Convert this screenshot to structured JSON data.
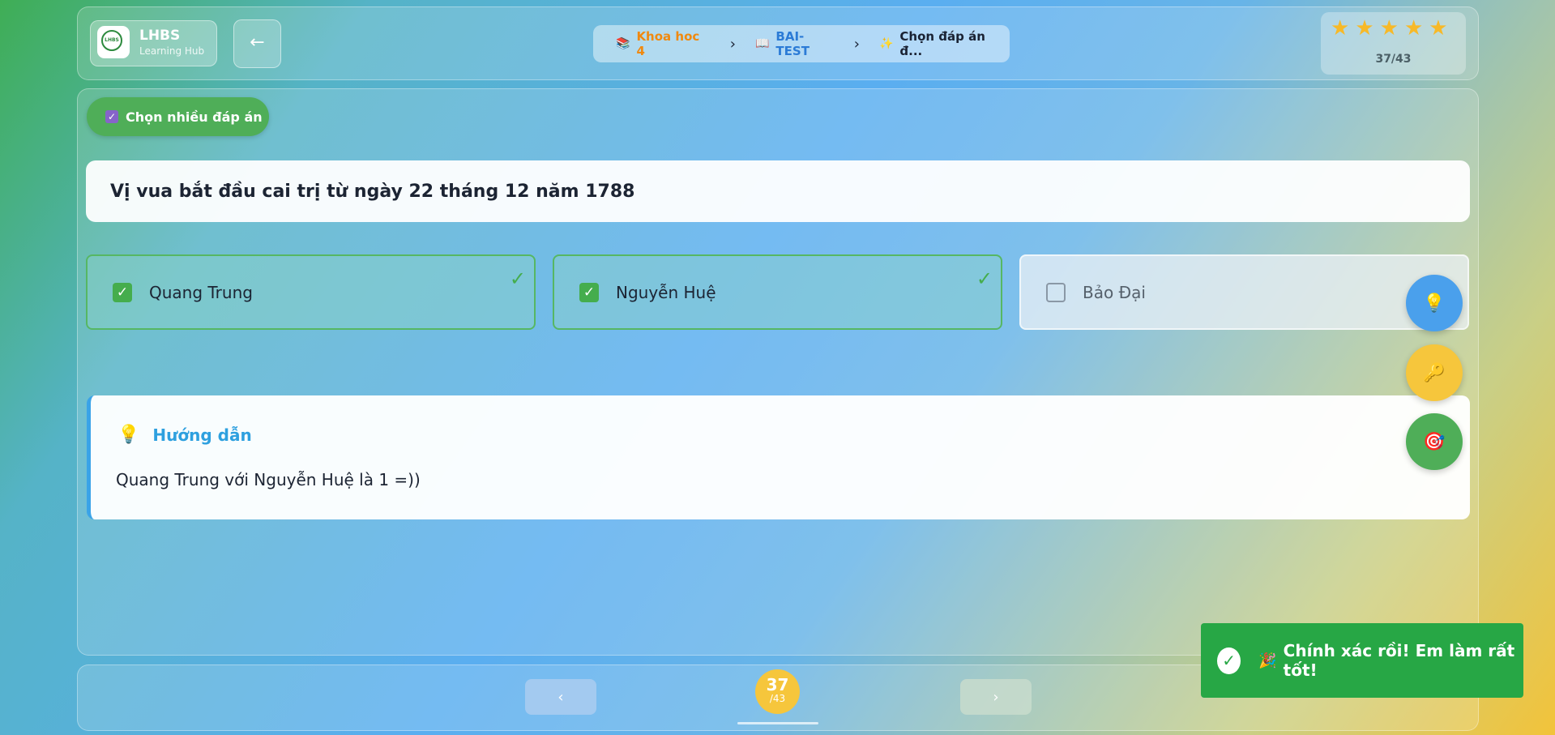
{
  "header": {
    "logo_badge_text": "LHBS",
    "logo_name": "LHBS",
    "logo_sub": "Learning Hub",
    "back_icon": "arrow-left-icon",
    "breadcrumb": [
      {
        "label": "Khoa hoc 4",
        "icon": "books-icon"
      },
      {
        "label": "BAI-TEST",
        "icon": "open-book-icon"
      },
      {
        "label": "Chọn đáp án đ...",
        "icon": "sparkles-icon"
      }
    ],
    "stars_count": 5,
    "star_progress": "37/43"
  },
  "question_type": "Chọn nhiều đáp án",
  "question_text": "Vị vua bắt đầu cai trị từ ngày 22 tháng 12 năm 1788",
  "options": [
    {
      "label": "Quang Trung",
      "selected": true
    },
    {
      "label": "Nguyễn Huệ",
      "selected": true
    },
    {
      "label": "Bảo Đại",
      "selected": false
    }
  ],
  "guide": {
    "title": "Hướng dẫn",
    "body": "Quang Trung với Nguyễn Huệ là 1 =))"
  },
  "fabs": [
    "lightbulb-icon",
    "key-icon",
    "target-icon"
  ],
  "pager": {
    "current": "37",
    "total": "/43",
    "prev_icon": "chevron-left-icon",
    "next_icon": "chevron-right-icon"
  },
  "toast": {
    "message": "Chính xác rồi! Em làm rất tốt!",
    "icon": "check-circle-icon"
  },
  "colors": {
    "success": "#27a745",
    "accent_orange": "#f0890f",
    "accent_blue": "#2b7bd6",
    "star": "#f7b928"
  }
}
